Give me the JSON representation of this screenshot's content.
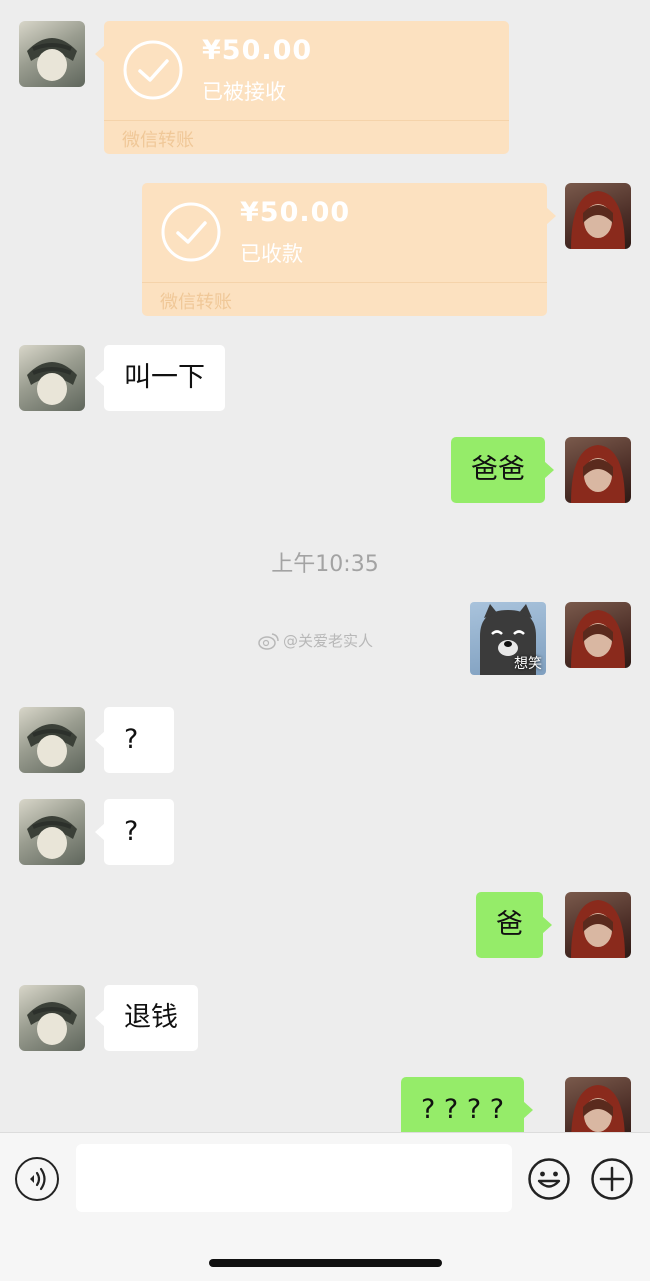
{
  "messages": {
    "transfer_received": {
      "amount": "¥50.00",
      "status": "已被接收",
      "footer": "微信转账"
    },
    "transfer_collected": {
      "amount": "¥50.00",
      "status": "已收款",
      "footer": "微信转账"
    },
    "msg1": "叫一下",
    "msg2": "爸爸",
    "timestamp": "上午10:35",
    "sticker_caption": "想笑",
    "msg3": "?",
    "msg4": "?",
    "msg5": "爸",
    "msg6": "退钱",
    "msg7": "? ? ? ?"
  },
  "watermark": "@关爱老实人",
  "icons": {
    "voice": "voice-icon",
    "emoji": "emoji-icon",
    "plus": "plus-icon",
    "check": "check-circle-icon"
  },
  "colors": {
    "background": "#ededed",
    "green_bubble": "#95ec69",
    "white_bubble": "#ffffff",
    "transfer": "#fce1c0"
  }
}
